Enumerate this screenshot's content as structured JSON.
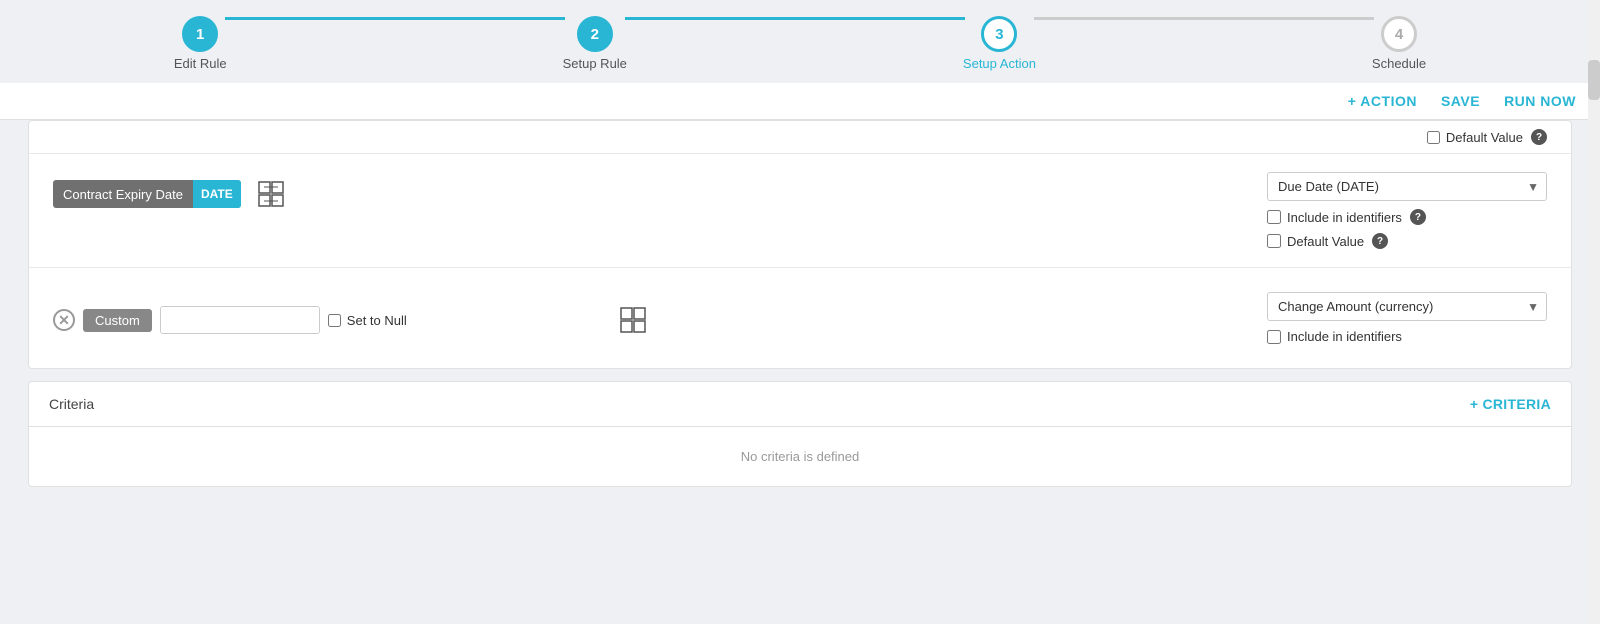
{
  "stepper": {
    "steps": [
      {
        "id": 1,
        "label": "Edit Rule",
        "state": "completed"
      },
      {
        "id": 2,
        "label": "Setup Rule",
        "state": "completed"
      },
      {
        "id": 3,
        "label": "Setup Action",
        "state": "active"
      },
      {
        "id": 4,
        "label": "Schedule",
        "state": "inactive"
      }
    ]
  },
  "toolbar": {
    "action_label": "+ ACTION",
    "save_label": "SAVE",
    "run_now_label": "RUN NOW"
  },
  "rows": {
    "contract_expiry": {
      "field_name": "Contract Expiry Date",
      "field_type": "DATE",
      "dropdown_value": "Due Date (DATE)",
      "include_in_identifiers_label": "Include in identifiers",
      "default_value_label": "Default Value"
    },
    "custom": {
      "custom_label": "Custom",
      "set_to_null_label": "Set to Null",
      "dropdown_value": "Change Amount (currency)",
      "include_in_identifiers_label": "Include in identifiers"
    }
  },
  "partial_header": {
    "default_value_label": "Default Value"
  },
  "criteria": {
    "title": "Criteria",
    "add_button": "+ CRITERIA",
    "empty_message": "No criteria is defined"
  },
  "icons": {
    "mapping": "⊞",
    "remove": "✕",
    "help": "?",
    "dropdown_arrow": "▼"
  }
}
